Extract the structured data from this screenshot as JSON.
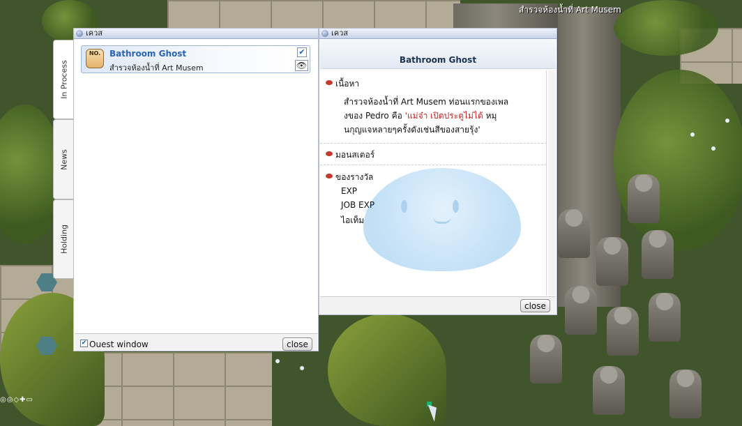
{
  "scene": {
    "location_text": "สำรวจห้องน้ำที่ Art Musem",
    "hud_glyphs": "◎◎◇✚▭"
  },
  "quest_window": {
    "title": "เควส",
    "tabs": [
      "In Process",
      "News",
      "Holding"
    ],
    "active_tab": "In Process",
    "quests": [
      {
        "icon_label": "NO.",
        "name": "Bathroom Ghost",
        "subtitle": "สำรวจห้องน้ำที่ Art Musem",
        "checked": true
      }
    ],
    "show_window_label": "Ouest window",
    "show_window_checked": true,
    "close_label": "close"
  },
  "detail_window": {
    "title": "เควส",
    "quest_title": "Bathroom Ghost",
    "sections": {
      "description_head": "เนื้อหา",
      "monster_head": "มอนสเตอร์",
      "reward_head": "ของรางวัล"
    },
    "description": {
      "line1": "สำรวจห้องน้ำที่ Art Musem ท่อนแรกของเพล",
      "line2_start": "งของ Pedro คือ ",
      "line2_red": "'แม่จ๋า เปิดประตูไม่ได้",
      "line2_end": " หมุ",
      "line3": "นกุญแจหลายๆครั้งดังเช่นสีของสายรุ้ง'"
    },
    "rewards": [
      "EXP",
      "JOB EXP",
      "ไอเท็ม"
    ],
    "close_label": "close"
  }
}
